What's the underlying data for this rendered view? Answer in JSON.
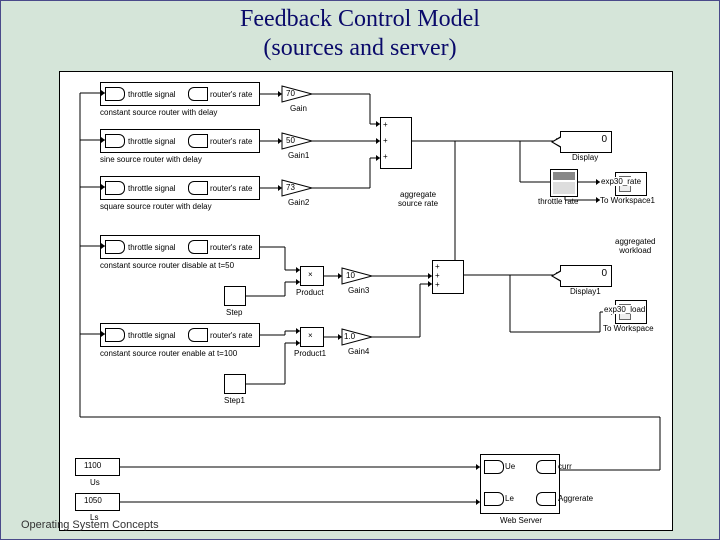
{
  "title_line1": "Feedback Control Model",
  "title_line2": "(sources and server)",
  "footer": "Operating System Concepts",
  "ports": {
    "throttle": "throttle signal",
    "routers_rate": "router's rate"
  },
  "srcblocks": {
    "s1": "constant source router with delay",
    "s2": "sine source router with delay",
    "s3": "square source router with delay",
    "s4": "constant source router disable at t=50",
    "s5": "constant source router enable at t=100"
  },
  "gains": {
    "g0v": "70",
    "g0l": "Gain",
    "g1v": "50",
    "g1l": "Gain1",
    "g2v": "73",
    "g2l": "Gain2",
    "g3v": "10",
    "g3l": "Gain3",
    "g4v": "1.0",
    "g4l": "Gain4"
  },
  "product": {
    "p0": "Product",
    "p1": "Product1"
  },
  "step": {
    "s0": "Step",
    "s1": "Step1"
  },
  "consts": {
    "c0": "1100",
    "c0l": "Us",
    "c1": "1050",
    "c1l": "Ls"
  },
  "aggSrc": "aggregate\nsource rate",
  "disp": {
    "d0l": "Display",
    "d0v": "0",
    "d1l": "Display1",
    "d1v": "0"
  },
  "scope": {
    "s0": "throttle rate"
  },
  "tows": {
    "t0": "exp30_rate",
    "t0l": "To Workspace1",
    "t1": "exp30_load",
    "t1l": "To Workspace"
  },
  "aggWork": "aggregated\nworkload",
  "ws": {
    "in1": "Ue",
    "in2": "Le",
    "out1": "curr",
    "out2": "Aggrerate",
    "label": "Web Server"
  }
}
